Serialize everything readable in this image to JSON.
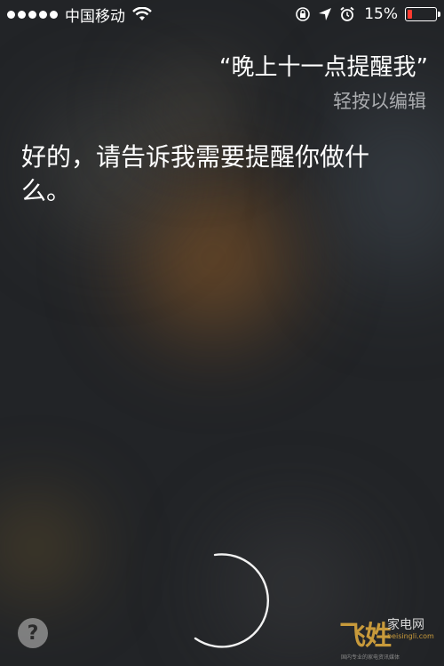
{
  "status_bar": {
    "signal_dots": 5,
    "carrier": "中国移动",
    "battery_percent_label": "15%",
    "battery_level": 0.15,
    "battery_color": "#ff3b30",
    "icons": [
      "wifi-icon",
      "rotation-lock-icon",
      "location-arrow-icon",
      "alarm-icon",
      "battery-icon"
    ]
  },
  "query": {
    "text": "“晚上十一点提醒我”",
    "edit_hint": "轻按以编辑"
  },
  "response": {
    "text": "好的，请告诉我需要提醒你做什么。"
  },
  "bottom": {
    "help_label": "?",
    "mic_icon": "siri-listening-ring-icon"
  },
  "watermark": {
    "logo": "飞姓",
    "text": "家电网",
    "sub": "beisingli.com",
    "tag": "国内专业的家电资讯媒体"
  }
}
